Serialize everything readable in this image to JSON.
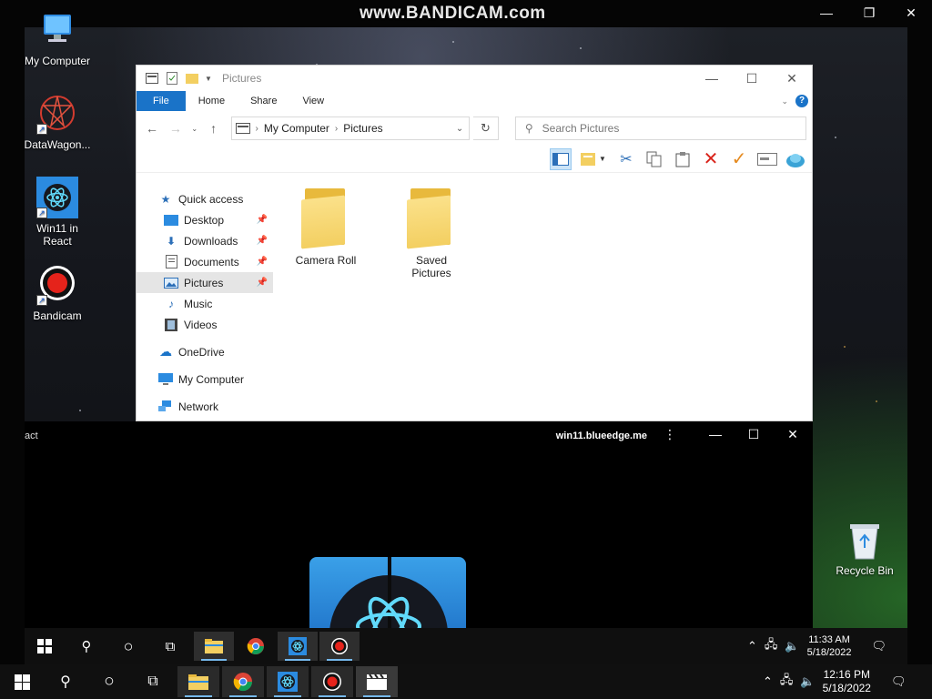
{
  "watermark": "www.BANDICAM.com",
  "desktop_icons": [
    {
      "label": "My Computer",
      "icon": "computer-icon"
    },
    {
      "label": "DataWagon...",
      "icon": "datawagon-icon"
    },
    {
      "label": "Win11 in React",
      "icon": "react-icon"
    },
    {
      "label": "Bandicam",
      "icon": "bandicam-icon"
    }
  ],
  "explorer": {
    "title": "Pictures",
    "ribbon_tabs": [
      "File",
      "Home",
      "Share",
      "View"
    ],
    "breadcrumb": [
      "My Computer",
      "Pictures"
    ],
    "search_placeholder": "Search Pictures",
    "nav": {
      "quick_access": "Quick access",
      "items": [
        "Desktop",
        "Downloads",
        "Documents",
        "Pictures",
        "Music",
        "Videos"
      ],
      "onedrive": "OneDrive",
      "my_computer": "My Computer",
      "network": "Network"
    },
    "files": [
      "Camera Roll",
      "Saved Pictures"
    ]
  },
  "appwin": {
    "title": "act",
    "url": "win11.blueedge.me"
  },
  "recycle_bin": "Recycle Bin",
  "inner_clock": {
    "time": "11:33 AM",
    "date": "5/18/2022"
  },
  "outer_clock": {
    "time": "12:16 PM",
    "date": "5/18/2022"
  },
  "colors": {
    "accent": "#1a73c8",
    "folder": "#f3cf61"
  }
}
